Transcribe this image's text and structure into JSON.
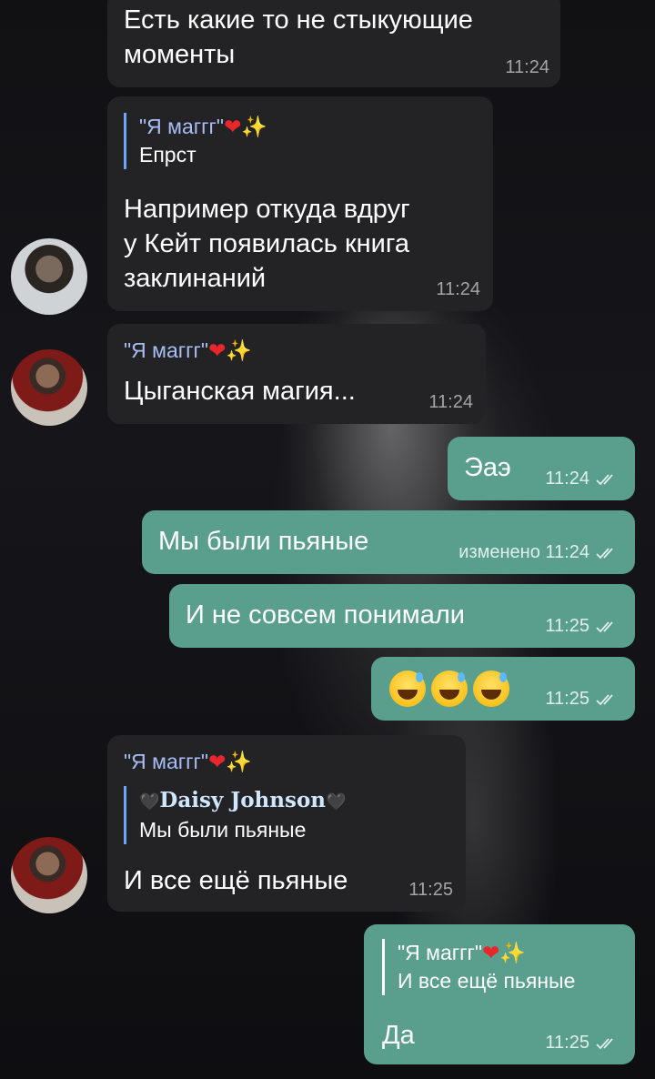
{
  "messages": [
    {
      "text_line1": "Есть какие то не стыкующие",
      "text_line2": "моменты",
      "time": "11:24"
    },
    {
      "quote_name": "\"Я маггг\"",
      "quote_text": "Епрст",
      "text_line1": "Например откуда вдруг",
      "text_line2": "у Кейт появилась книга",
      "text_line3": "заклинаний",
      "time": "11:24"
    },
    {
      "sender": "\"Я маггг\"",
      "text": "Цыганская магия...",
      "time": "11:24"
    },
    {
      "text": "Эаэ",
      "time": "11:24"
    },
    {
      "text": "Мы были пьяные",
      "edited": "изменено",
      "time": "11:24"
    },
    {
      "text": "И не совсем понимали",
      "time": "11:25"
    },
    {
      "time": "11:25"
    },
    {
      "sender": "\"Я маггг\"",
      "quote_name": "Daisy Johnson",
      "quote_text": "Мы были пьяные",
      "text": "И все ещё пьяные",
      "time": "11:25"
    },
    {
      "quote_name": "\"Я маггг\"",
      "quote_text": "И все ещё пьяные",
      "text": "Да",
      "time": "11:25"
    }
  ],
  "icons": {
    "heart": "❤",
    "sparkles": "✨",
    "black_heart": "🖤"
  },
  "colors": {
    "incoming": "#232326",
    "outgoing": "#5a9e8d",
    "sender": "#a7bdf5"
  }
}
